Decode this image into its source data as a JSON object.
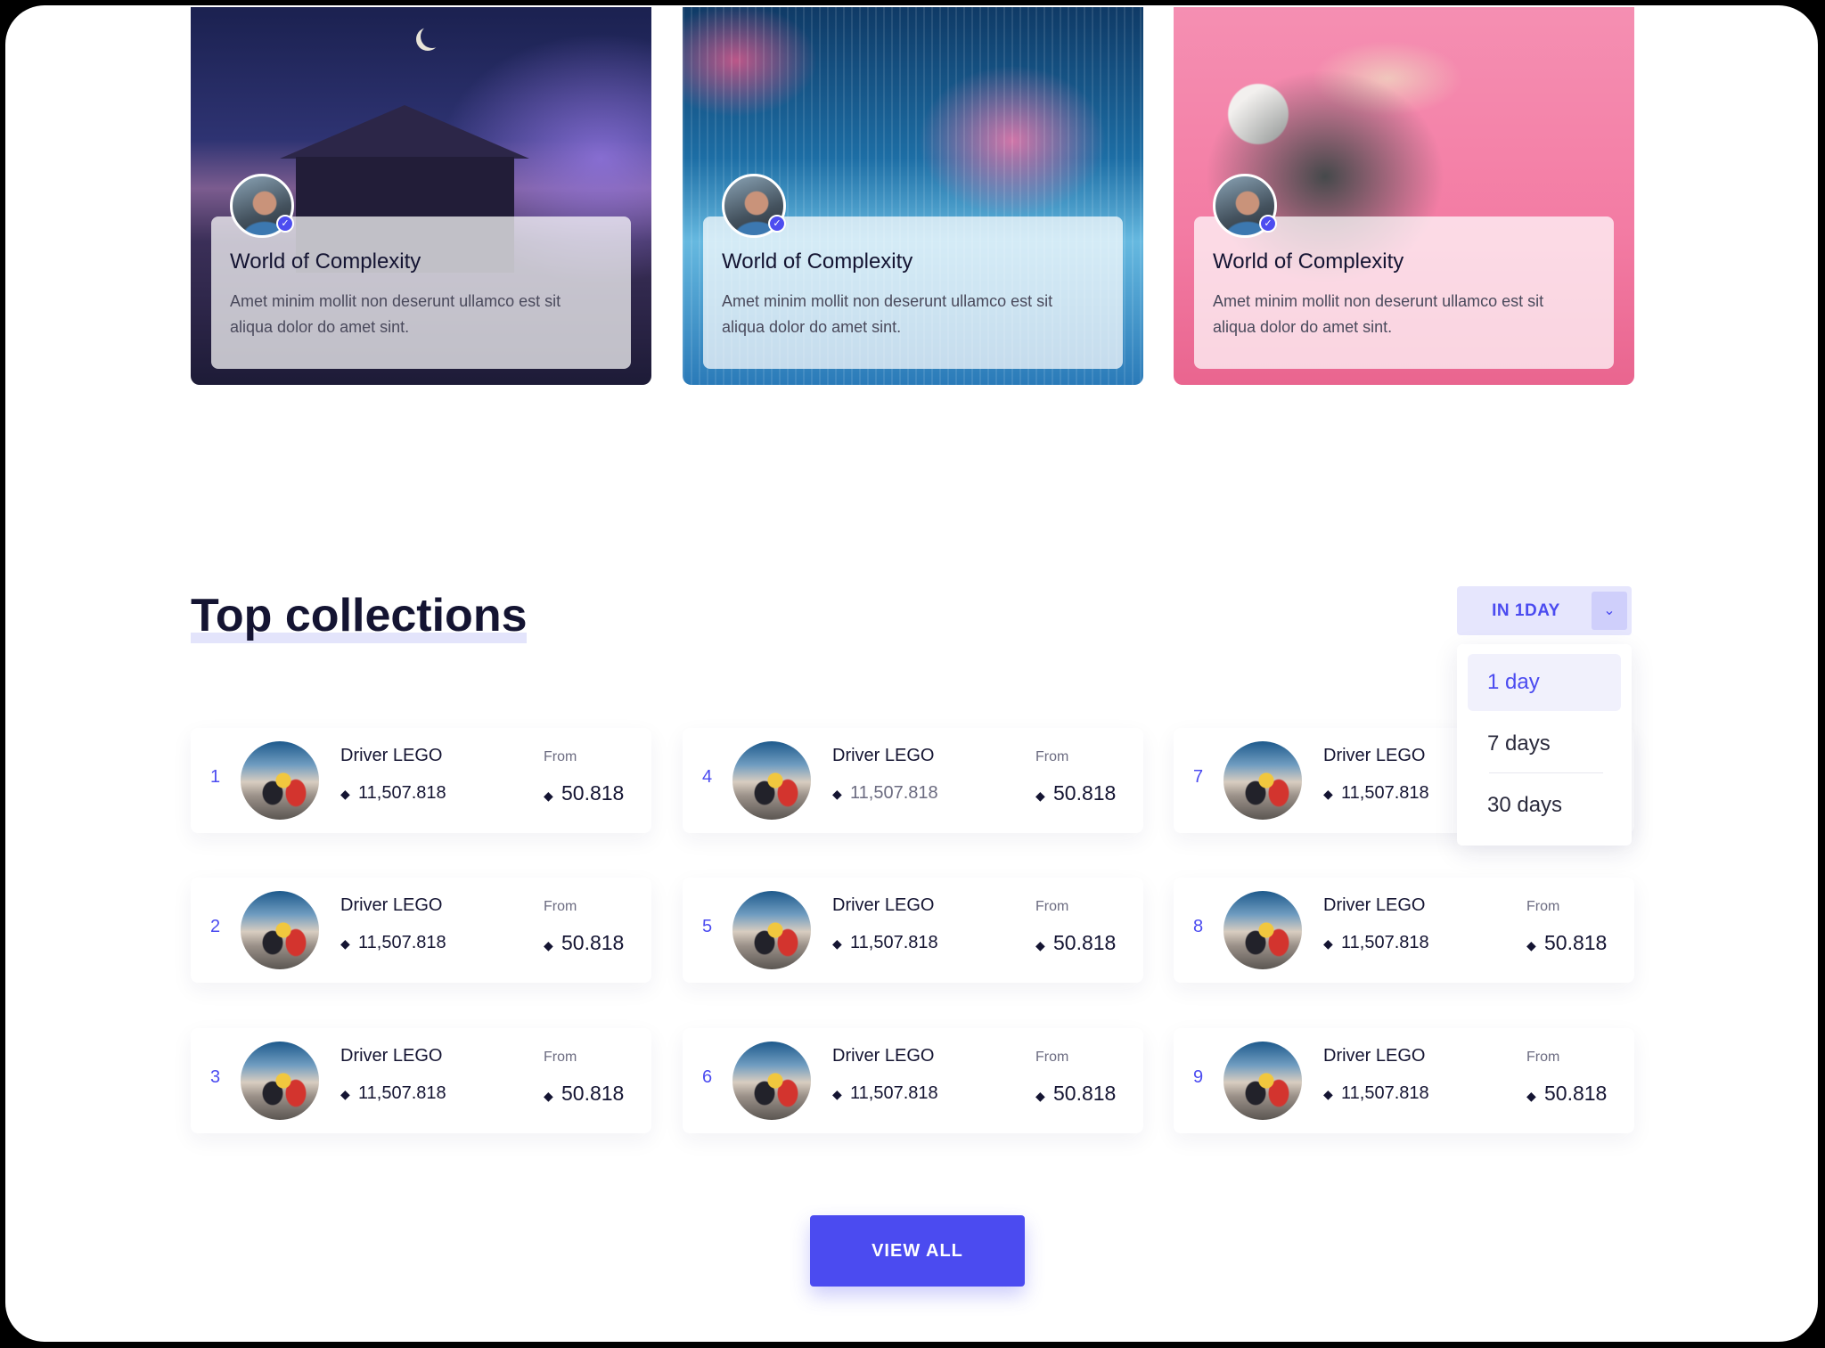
{
  "featured": [
    {
      "title": "World of Complexity",
      "description": "Amet minim mollit non deserunt ullamco est sit aliqua dolor do amet sint."
    },
    {
      "title": "World of Complexity",
      "description": "Amet minim mollit non deserunt ullamco est sit aliqua dolor do amet sint."
    },
    {
      "title": "World of Complexity",
      "description": "Amet minim mollit non deserunt ullamco est sit aliqua dolor do amet sint."
    }
  ],
  "section": {
    "title": "Top collections"
  },
  "period": {
    "selected_label": "IN 1DAY",
    "options": [
      "1 day",
      "7 days",
      "30 days"
    ],
    "selected_option": "1 day"
  },
  "collections": [
    {
      "rank": "1",
      "name": "Driver LEGO",
      "volume": "11,507.818",
      "from_label": "From",
      "floor": "50.818"
    },
    {
      "rank": "2",
      "name": "Driver LEGO",
      "volume": "11,507.818",
      "from_label": "From",
      "floor": "50.818"
    },
    {
      "rank": "3",
      "name": "Driver LEGO",
      "volume": "11,507.818",
      "from_label": "From",
      "floor": "50.818"
    },
    {
      "rank": "4",
      "name": "Driver LEGO",
      "volume": "11,507.818",
      "from_label": "From",
      "floor": "50.818"
    },
    {
      "rank": "5",
      "name": "Driver LEGO",
      "volume": "11,507.818",
      "from_label": "From",
      "floor": "50.818"
    },
    {
      "rank": "6",
      "name": "Driver LEGO",
      "volume": "11,507.818",
      "from_label": "From",
      "floor": "50.818"
    },
    {
      "rank": "7",
      "name": "Driver LEGO",
      "volume": "11,507.818",
      "from_label": "",
      "floor": ""
    },
    {
      "rank": "8",
      "name": "Driver LEGO",
      "volume": "11,507.818",
      "from_label": "From",
      "floor": "50.818"
    },
    {
      "rank": "9",
      "name": "Driver LEGO",
      "volume": "11,507.818",
      "from_label": "From",
      "floor": "50.818"
    }
  ],
  "icons": {
    "currency": "ethereum-icon",
    "verified": "verified-badge-icon",
    "dropdown": "chevron-down-icon"
  },
  "colors": {
    "accent": "#4B4BF0",
    "accent_soft": "#E6E6FD",
    "text": "#141432"
  },
  "view_all_label": "VIEW ALL"
}
